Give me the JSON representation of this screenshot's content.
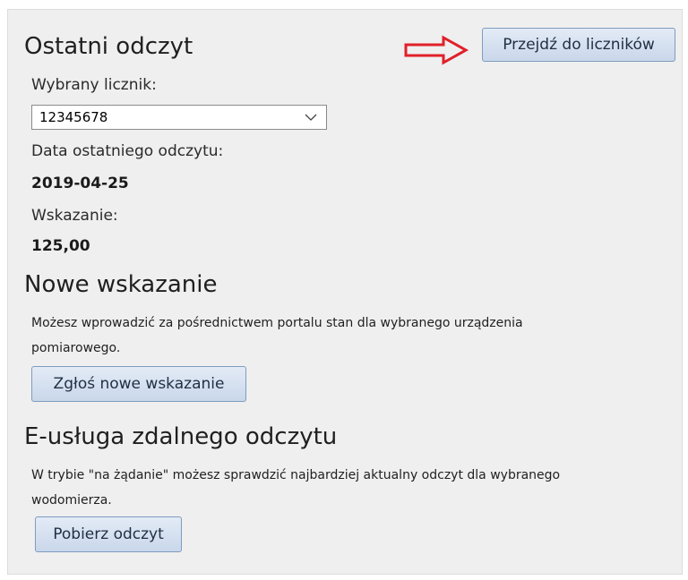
{
  "last_reading": {
    "title": "Ostatni odczyt",
    "go_to_meters_label": "Przejdź do liczników",
    "selected_meter_label": "Wybrany licznik:",
    "selected_meter_value": "12345678",
    "last_reading_date_label": "Data ostatniego odczytu:",
    "last_reading_date": "2019-04-25",
    "indication_label": "Wskazanie:",
    "indication_value": "125,00"
  },
  "new_indication": {
    "title": "Nowe wskazanie",
    "description": "Możesz wprowadzić za pośrednictwem portalu stan dla wybranego urządzenia",
    "description_line2": "pomiarowego.",
    "button_label": "Zgłoś nowe wskazanie"
  },
  "remote_reading": {
    "title": "E-usługa zdalnego odczytu",
    "description": "W trybie \"na żądanie\" możesz sprawdzić najbardziej aktualny odczyt dla wybranego",
    "description_line2": "wodomierza.",
    "button_label": "Pobierz odczyt"
  },
  "colors": {
    "annotation_arrow": "#e0202a",
    "button_border": "#7f9cc0",
    "panel_background": "#efefef"
  },
  "icons": {
    "annotation": "right-arrow-outline-icon",
    "dropdown": "chevron-down-icon"
  }
}
